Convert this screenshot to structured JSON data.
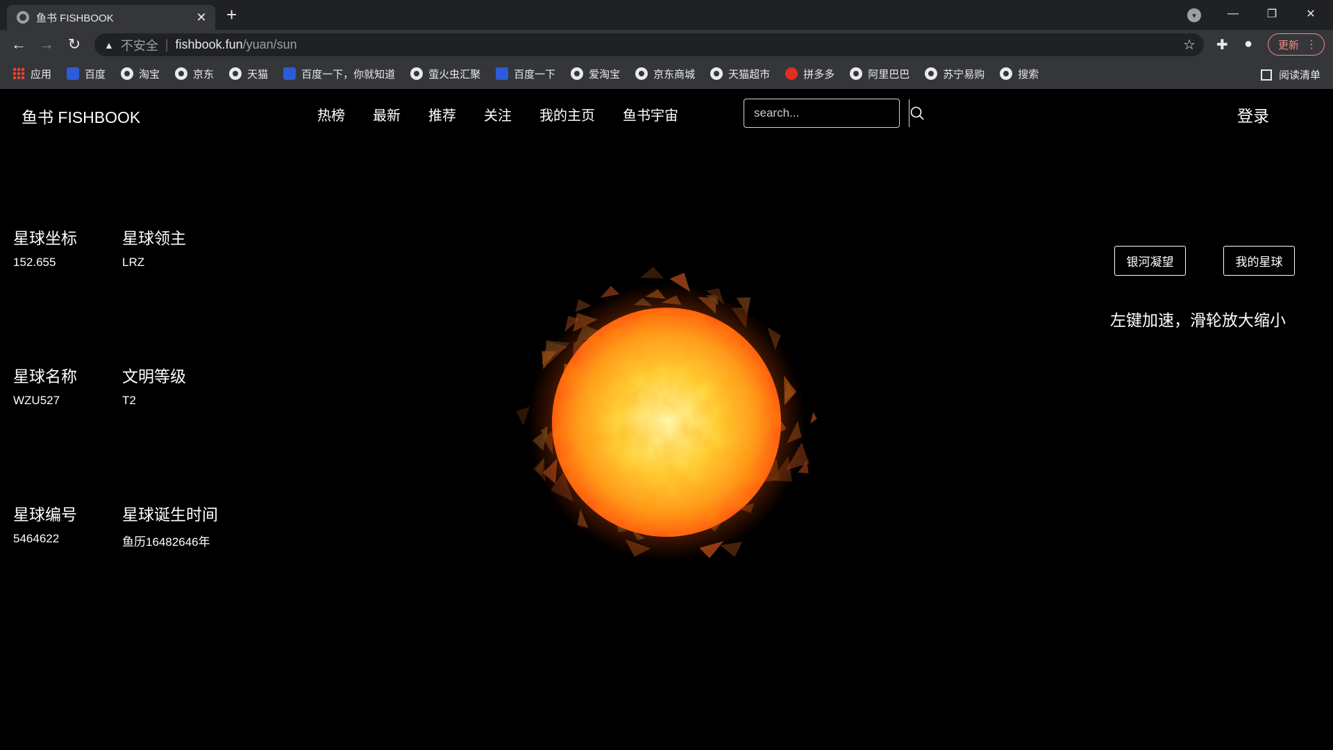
{
  "browser": {
    "tab_title": "鱼书 FISHBOOK",
    "tab_close": "✕",
    "new_tab": "+",
    "url_insecure": "不安全",
    "url_host": "fishbook.fun",
    "url_path": "/yuan/sun",
    "update_label": "更新",
    "reading_list": "阅读清单",
    "bookmarks": [
      {
        "label": "应用",
        "icon": "apps-icon"
      },
      {
        "label": "百度",
        "icon": "paw-icon"
      },
      {
        "label": "淘宝",
        "icon": "globe-icon"
      },
      {
        "label": "京东",
        "icon": "globe-icon"
      },
      {
        "label": "天猫",
        "icon": "globe-icon"
      },
      {
        "label": "百度一下，你就知道",
        "icon": "paw-icon"
      },
      {
        "label": "萤火虫汇聚",
        "icon": "globe-icon"
      },
      {
        "label": "百度一下",
        "icon": "paw-icon"
      },
      {
        "label": "爱淘宝",
        "icon": "globe-icon"
      },
      {
        "label": "京东商城",
        "icon": "globe-icon"
      },
      {
        "label": "天猫超市",
        "icon": "globe-icon"
      },
      {
        "label": "拼多多",
        "icon": "pdd-icon"
      },
      {
        "label": "阿里巴巴",
        "icon": "globe-icon"
      },
      {
        "label": "苏宁易购",
        "icon": "globe-icon"
      },
      {
        "label": "搜索",
        "icon": "globe-icon"
      }
    ]
  },
  "site": {
    "logo": "鱼书 FISHBOOK",
    "nav": [
      "热榜",
      "最新",
      "推荐",
      "关注",
      "我的主页",
      "鱼书宇宙"
    ],
    "search_placeholder": "search...",
    "login": "登录"
  },
  "planet": {
    "coord_label": "星球坐标",
    "coord_value": "152.655",
    "owner_label": "星球领主",
    "owner_value": "LRZ",
    "name_label": "星球名称",
    "name_value": "WZU527",
    "level_label": "文明等级",
    "level_value": "T2",
    "id_label": "星球编号",
    "id_value": "5464622",
    "birth_label": "星球诞生时间",
    "birth_value": "鱼历16482646年"
  },
  "actions": {
    "galaxy_button": "银河凝望",
    "my_planet_button": "我的星球",
    "hint": "左键加速，滑轮放大缩小"
  },
  "colors": {
    "page_bg": "#000000",
    "chrome_dark": "#202124",
    "chrome_mid": "#35363a",
    "update_accent": "#f28b82",
    "sun_core": "#fff27a",
    "sun_edge": "#ff5a10"
  }
}
